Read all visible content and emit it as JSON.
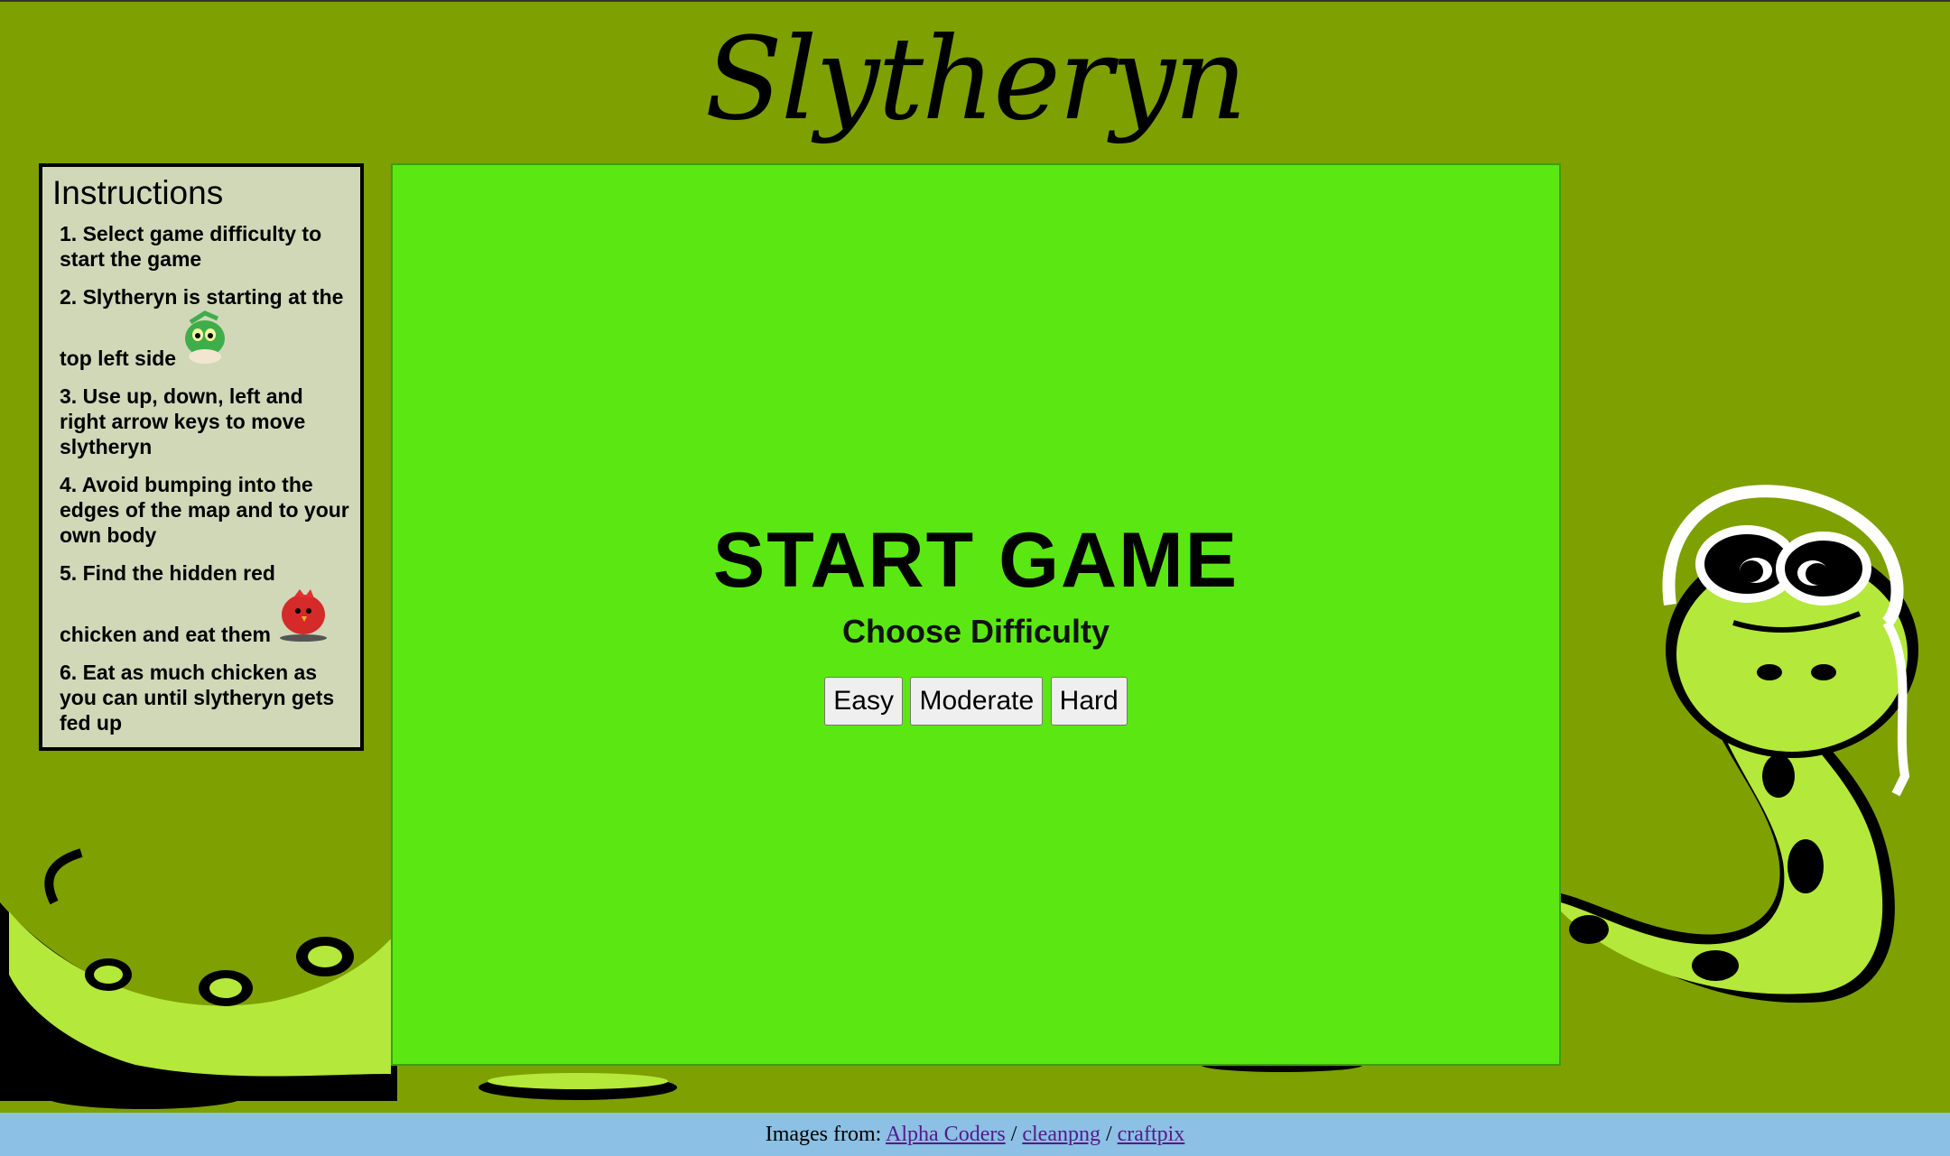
{
  "app": {
    "title": "Slytheryn"
  },
  "instructions": {
    "heading": "Instructions",
    "steps": [
      "1. Select game difficulty to start the game",
      "2. Slytheryn is starting at the top left side",
      "3. Use up, down, left and right arrow keys to move slytheryn",
      "4. Avoid bumping into the edges of the map and to your own body",
      "5. Find the hidden red chicken and eat them",
      "6. Eat as much chicken as you can until slytheryn gets fed up"
    ]
  },
  "game": {
    "start_title": "START GAME",
    "choose_label": "Choose Difficulty",
    "difficulty_buttons": [
      "Easy",
      "Moderate",
      "Hard"
    ]
  },
  "footer": {
    "prefix": "Images from:",
    "links": [
      "Alpha Coders",
      "cleanpng",
      "craftpix"
    ],
    "separator": "/"
  },
  "colors": {
    "page_bg": "#7ea000",
    "game_bg": "#5be812",
    "panel_bg": "#d0d8b8",
    "footer_bg": "#8cc0e4",
    "snake_body": "#b4e83a"
  }
}
